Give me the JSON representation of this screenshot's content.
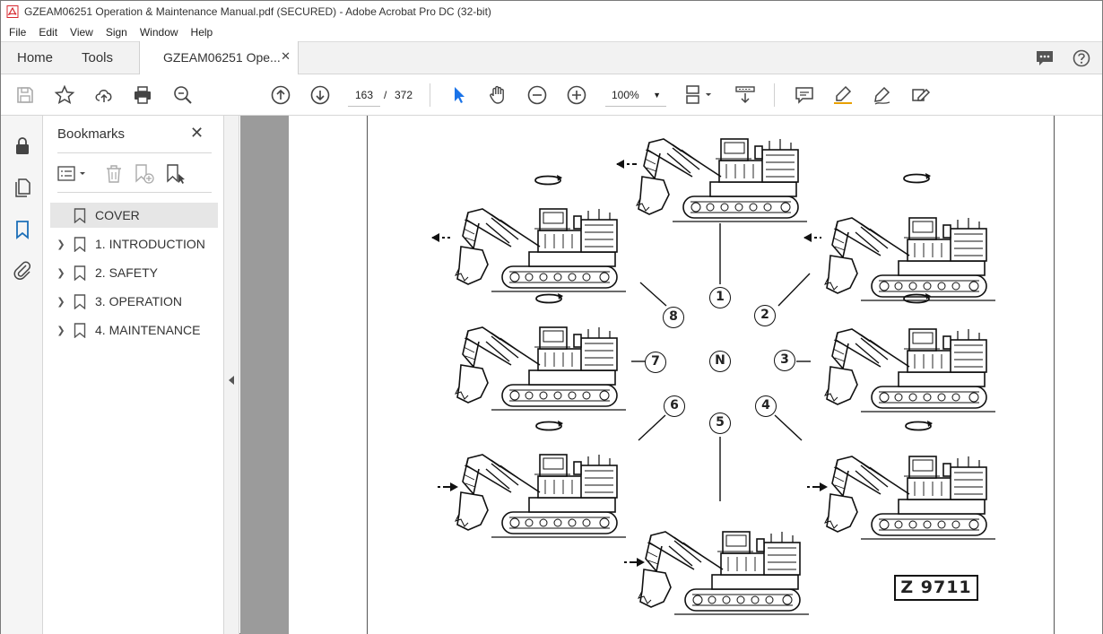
{
  "window": {
    "title": "GZEAM06251 Operation & Maintenance Manual.pdf (SECURED) - Adobe Acrobat Pro DC (32-bit)",
    "menu": [
      "File",
      "Edit",
      "View",
      "Sign",
      "Window",
      "Help"
    ]
  },
  "tabs": {
    "home": "Home",
    "tools": "Tools",
    "document": "GZEAM06251 Ope...",
    "close": "✕"
  },
  "toolbar": {
    "current_page": "163",
    "page_separator": "/",
    "total_pages": "372",
    "zoom": "100%"
  },
  "bookmarks": {
    "title": "Bookmarks",
    "close": "✕",
    "items": [
      {
        "label": "COVER",
        "expandable": false,
        "selected": true
      },
      {
        "label": "1. INTRODUCTION",
        "expandable": true,
        "selected": false
      },
      {
        "label": "2. SAFETY",
        "expandable": true,
        "selected": false
      },
      {
        "label": "3. OPERATION",
        "expandable": true,
        "selected": false
      },
      {
        "label": "4. MAINTENANCE",
        "expandable": true,
        "selected": false
      }
    ]
  },
  "figure": {
    "code": "Z 9711",
    "positions": [
      "1",
      "2",
      "3",
      "4",
      "5",
      "6",
      "7",
      "8"
    ],
    "center": "N"
  },
  "colors": {
    "accent": "#1a73e8",
    "adobe_red": "#d7282f",
    "bookmark_icon": "#1c6fb8"
  }
}
